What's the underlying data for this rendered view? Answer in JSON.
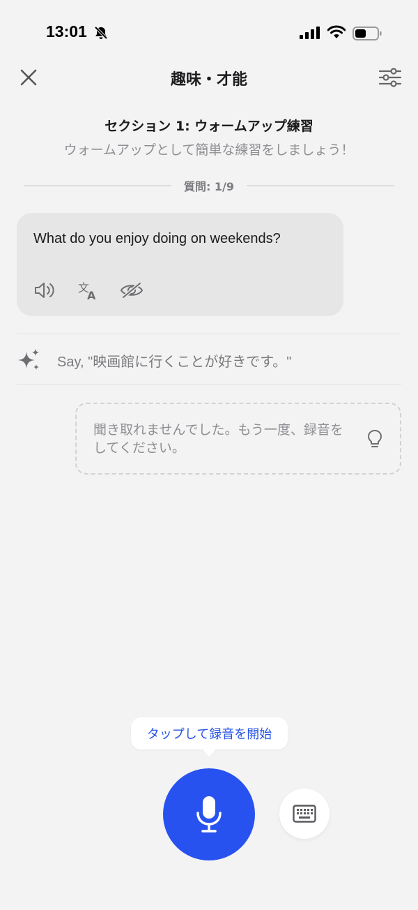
{
  "status_bar": {
    "time": "13:01",
    "icons": [
      "bell-slash-icon",
      "signal-icon",
      "wifi-icon",
      "battery-icon"
    ]
  },
  "header": {
    "title": "趣味・才能",
    "close_icon": "close-icon",
    "settings_icon": "sliders-icon"
  },
  "section": {
    "title": "セクション 1: ウォームアップ練習",
    "subtitle": "ウォームアップとして簡単な練習をしましょう！",
    "question_count": "質問: 1/9"
  },
  "question": {
    "text": "What do you enjoy doing on weekends?",
    "actions": [
      "speaker-icon",
      "translate-icon",
      "eye-slash-icon"
    ]
  },
  "hint": {
    "icon": "sparkles-icon",
    "text": "Say, \"映画館に行くことが好きです。\""
  },
  "answer": {
    "text": "聞き取れませんでした。もう一度、録音をしてください。",
    "icon": "lightbulb-icon"
  },
  "bottom": {
    "tooltip": "タップして録音を開始",
    "mic_icon": "microphone-icon",
    "keyboard_icon": "keyboard-icon"
  },
  "colors": {
    "accent": "#2752f0",
    "tooltip_text": "#2653e6",
    "background": "#f3f3f3"
  }
}
